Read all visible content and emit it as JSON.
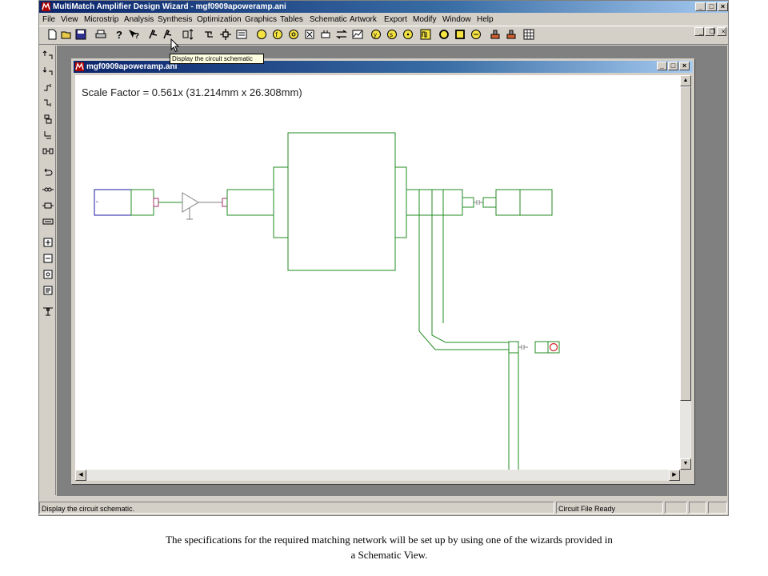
{
  "window": {
    "title": "MultiMatch Amplifier Design Wizard - mgf0909apoweramp.ani",
    "controls": [
      "minimize",
      "maximize",
      "close"
    ]
  },
  "menu": [
    "File",
    "View",
    "Microstrip",
    "Analysis",
    "Synthesis",
    "Optimization",
    "Graphics",
    "Tables",
    "Schematic",
    "Artwork",
    "Export",
    "Modify",
    "Window",
    "Help"
  ],
  "toolbar": {
    "tooltip": "Display the circuit schematic",
    "icons": [
      "new-icon",
      "open-icon",
      "save-icon",
      "print-icon",
      "help-icon",
      "context-help-icon",
      "pen-icon",
      "pen-alt-icon",
      "resize-icon",
      "schematic-icon",
      "component-icon",
      "card-icon",
      "circle-icon",
      "circle-f-icon",
      "circle-dot-icon",
      "box-x-icon",
      "box-plug-icon",
      "arrows-icon",
      "chart-icon",
      "circle-y-icon",
      "circle-s-icon",
      "circle-point-icon",
      "pulse-icon",
      "circle-open-icon",
      "square-icon",
      "circle-minus-icon",
      "stamp-icon",
      "stamp-alt-icon",
      "grid-icon"
    ]
  },
  "palette": [
    "up-arrow-icon",
    "down-arrow-icon",
    "up-step-icon",
    "down-step-icon",
    "stub-icon",
    "tee-icon",
    "coupler-icon",
    "undo-icon",
    "series-icon",
    "shunt-icon",
    "resistor-icon",
    "add-icon",
    "remove-icon",
    "zoom-icon",
    "export-icon",
    "antenna-icon"
  ],
  "document": {
    "title": "mgf0909apoweramp.ani",
    "scale_factor": "Scale Factor =  0.561x (31.214mm x 26.308mm)"
  },
  "colors": {
    "line_green": "#228b22",
    "port_blue": "#1a1aa0",
    "marker_red": "#d02020",
    "title_blue": "#0a246a"
  },
  "status": {
    "message": "Display the circuit schematic.",
    "file_status": "Circuit File Ready"
  },
  "caption": {
    "line1": "The specifications for the required matching network will be set up by using one of the wizards provided in",
    "line2": "a Schematic View."
  }
}
